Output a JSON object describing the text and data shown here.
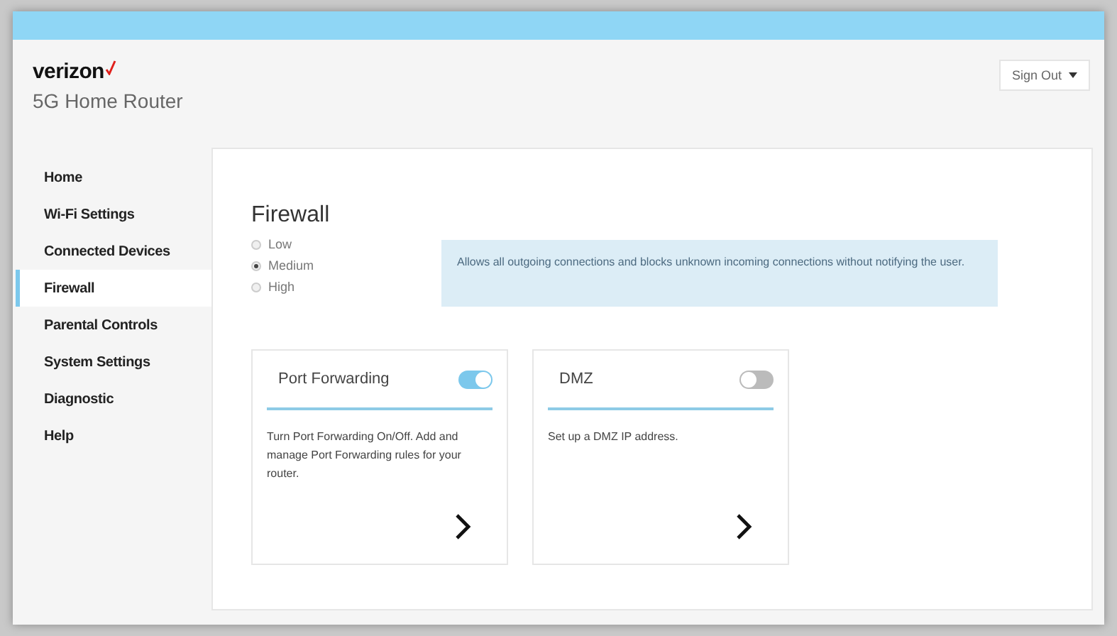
{
  "header": {
    "logo": "verizon",
    "product": "5G Home Router",
    "sign_out": "Sign Out"
  },
  "sidebar": {
    "items": [
      {
        "label": "Home",
        "selected": false
      },
      {
        "label": "Wi-Fi Settings",
        "selected": false
      },
      {
        "label": "Connected Devices",
        "selected": false
      },
      {
        "label": "Firewall",
        "selected": true
      },
      {
        "label": "Parental Controls",
        "selected": false
      },
      {
        "label": "System Settings",
        "selected": false
      },
      {
        "label": "Diagnostic",
        "selected": false
      },
      {
        "label": "Help",
        "selected": false
      }
    ]
  },
  "main": {
    "title": "Firewall",
    "levels": [
      {
        "label": "Low",
        "selected": false
      },
      {
        "label": "Medium",
        "selected": true
      },
      {
        "label": "High",
        "selected": false
      }
    ],
    "info": "Allows all outgoing connections and blocks unknown incoming connections without notifying the user.",
    "cards": [
      {
        "title": "Port Forwarding",
        "on": true,
        "description": "Turn Port Forwarding On/Off. Add and manage Port Forwarding rules for your router."
      },
      {
        "title": "DMZ",
        "on": false,
        "description": "Set up a DMZ IP address."
      }
    ]
  }
}
